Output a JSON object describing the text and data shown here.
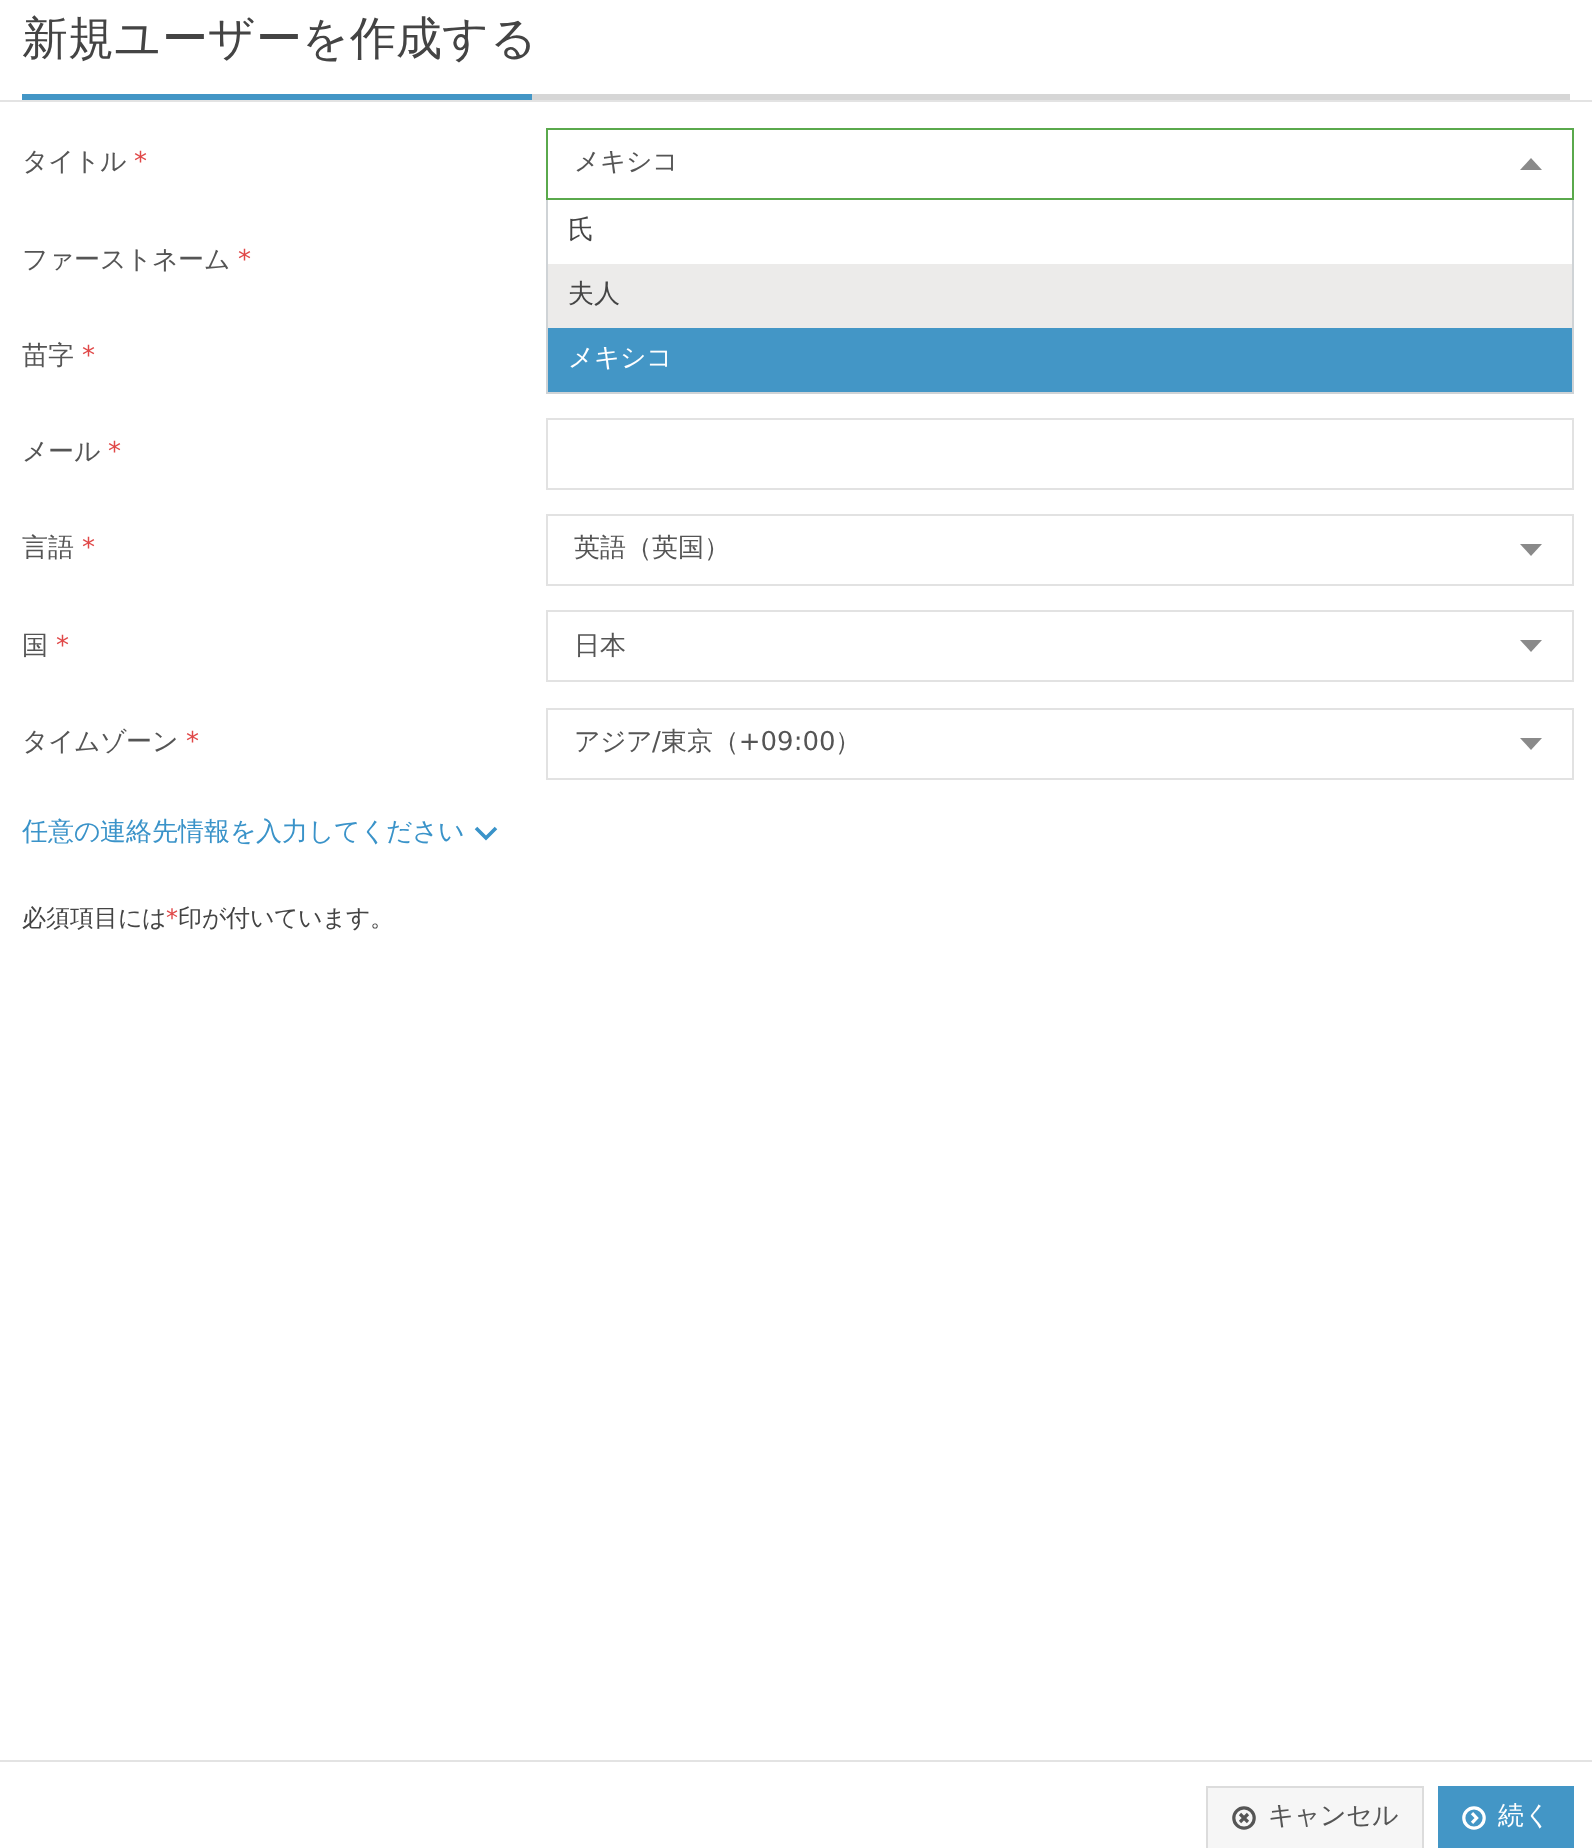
{
  "header": {
    "title": "新規ユーザーを作成する",
    "progress": {
      "level": 0.33
    }
  },
  "fields": [
    {
      "label": "タイトル",
      "mark": "*",
      "control": {
        "kind": "select",
        "value": "メキシコ",
        "focused": true,
        "expanded": true,
        "options": [
          {
            "label": "氏",
            "highlighted": false,
            "selected": false
          },
          {
            "label": "夫人",
            "highlighted": true,
            "selected": false
          },
          {
            "label": "メキシコ",
            "highlighted": false,
            "selected": true
          }
        ]
      }
    },
    {
      "label": "ファーストネーム",
      "mark": "*"
    },
    {
      "label": "苗字",
      "mark": "*"
    },
    {
      "label": "メール",
      "mark": "*",
      "control": {
        "kind": "text"
      }
    },
    {
      "label": "言語",
      "mark": "*",
      "control": {
        "kind": "select",
        "value": "英語（英国）",
        "focused": false,
        "expanded": false
      }
    },
    {
      "label": "国",
      "mark": "*",
      "control": {
        "kind": "select",
        "value": "日本",
        "focused": false,
        "expanded": false
      }
    },
    {
      "label": "タイムゾーン",
      "mark": "*",
      "control": {
        "kind": "select",
        "value": "アジア/東京（+09:00）",
        "focused": false,
        "expanded": false
      }
    }
  ],
  "optional_link": {
    "text": "任意の連絡先情報を入力してください",
    "expanded": false
  },
  "required_note": {
    "before": "必須項目には",
    "mark": "*",
    "after": "印が付いています。"
  },
  "buttons": [
    {
      "label": "キャンセル",
      "kind": "secondary"
    },
    {
      "label": "続く",
      "kind": "primary"
    }
  ]
}
